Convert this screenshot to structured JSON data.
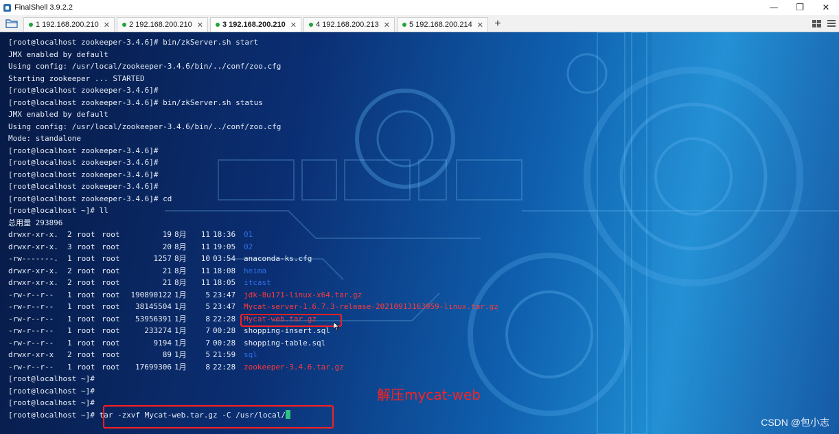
{
  "window": {
    "title": "FinalShell 3.9.2.2",
    "minimize_glyph": "—",
    "maximize_glyph": "❐",
    "close_glyph": "✕"
  },
  "tabs": [
    {
      "label": "1 192.168.200.210",
      "active": false
    },
    {
      "label": "2 192.168.200.210",
      "active": false
    },
    {
      "label": "3 192.168.200.210",
      "active": true
    },
    {
      "label": "4 192.168.200.213",
      "active": false
    },
    {
      "label": "5 192.168.200.214",
      "active": false
    }
  ],
  "tab_close_glyph": "✕",
  "add_tab_glyph": "+",
  "colors": {
    "dir": "#2f6fe6",
    "archive": "#ff3b3b",
    "highlight": "#ff1f1f",
    "status_dot": "#23a33a"
  },
  "terminal": {
    "lines_before": [
      "[root@localhost zookeeper-3.4.6]# bin/zkServer.sh start",
      "JMX enabled by default",
      "Using config: /usr/local/zookeeper-3.4.6/bin/../conf/zoo.cfg",
      "Starting zookeeper ... STARTED",
      "[root@localhost zookeeper-3.4.6]#",
      "[root@localhost zookeeper-3.4.6]# bin/zkServer.sh status",
      "JMX enabled by default",
      "Using config: /usr/local/zookeeper-3.4.6/bin/../conf/zoo.cfg",
      "Mode: standalone",
      "[root@localhost zookeeper-3.4.6]#",
      "[root@localhost zookeeper-3.4.6]#",
      "[root@localhost zookeeper-3.4.6]#",
      "[root@localhost zookeeper-3.4.6]#",
      "[root@localhost zookeeper-3.4.6]# cd",
      "[root@localhost ~]# ll",
      "总用量 293896"
    ],
    "listing": [
      {
        "perm": "drwxr-xr-x.",
        "links": "2",
        "owner": "root",
        "group": "root",
        "size": "19",
        "month": "8月",
        "day": "11",
        "time": "18:36",
        "name": "01",
        "kind": "dir"
      },
      {
        "perm": "drwxr-xr-x.",
        "links": "3",
        "owner": "root",
        "group": "root",
        "size": "20",
        "month": "8月",
        "day": "11",
        "time": "19:05",
        "name": "02",
        "kind": "dir"
      },
      {
        "perm": "-rw-------.",
        "links": "1",
        "owner": "root",
        "group": "root",
        "size": "1257",
        "month": "8月",
        "day": "10",
        "time": "03:54",
        "name": "anaconda-ks.cfg",
        "kind": "plain"
      },
      {
        "perm": "drwxr-xr-x.",
        "links": "2",
        "owner": "root",
        "group": "root",
        "size": "21",
        "month": "8月",
        "day": "11",
        "time": "18:08",
        "name": "heima",
        "kind": "dir"
      },
      {
        "perm": "drwxr-xr-x.",
        "links": "2",
        "owner": "root",
        "group": "root",
        "size": "21",
        "month": "8月",
        "day": "11",
        "time": "18:05",
        "name": "itcast",
        "kind": "dir"
      },
      {
        "perm": "-rw-r--r--",
        "links": "1",
        "owner": "root",
        "group": "root",
        "size": "190890122",
        "month": "1月",
        "day": "5",
        "time": "23:47",
        "name": "jdk-8u171-linux-x64.tar.gz",
        "kind": "archive"
      },
      {
        "perm": "-rw-r--r--",
        "links": "1",
        "owner": "root",
        "group": "root",
        "size": "38145504",
        "month": "1月",
        "day": "5",
        "time": "23:47",
        "name": "Mycat-server-1.6.7.3-release-20210913163959-linux.tar.gz",
        "kind": "archive"
      },
      {
        "perm": "-rw-r--r--",
        "links": "1",
        "owner": "root",
        "group": "root",
        "size": "53956391",
        "month": "1月",
        "day": "8",
        "time": "22:28",
        "name": "Mycat-web.tar.gz",
        "kind": "archive"
      },
      {
        "perm": "-rw-r--r--",
        "links": "1",
        "owner": "root",
        "group": "root",
        "size": "233274",
        "month": "1月",
        "day": "7",
        "time": "00:28",
        "name": "shopping-insert.sql",
        "kind": "plain"
      },
      {
        "perm": "-rw-r--r--",
        "links": "1",
        "owner": "root",
        "group": "root",
        "size": "9194",
        "month": "1月",
        "day": "7",
        "time": "00:28",
        "name": "shopping-table.sql",
        "kind": "plain"
      },
      {
        "perm": "drwxr-xr-x",
        "links": "2",
        "owner": "root",
        "group": "root",
        "size": "89",
        "month": "1月",
        "day": "5",
        "time": "21:59",
        "name": "sql",
        "kind": "dir"
      },
      {
        "perm": "-rw-r--r--",
        "links": "1",
        "owner": "root",
        "group": "root",
        "size": "17699306",
        "month": "1月",
        "day": "8",
        "time": "22:28",
        "name": "zookeeper-3.4.6.tar.gz",
        "kind": "archive"
      }
    ],
    "lines_after": [
      "[root@localhost ~]#",
      "[root@localhost ~]#",
      "[root@localhost ~]#"
    ],
    "prompt": "[root@localhost ~]# ",
    "current_command": "tar -zxvf Mycat-web.tar.gz -C /usr/local/"
  },
  "annotation": "解压mycat-web",
  "watermark": "CSDN @包小志"
}
